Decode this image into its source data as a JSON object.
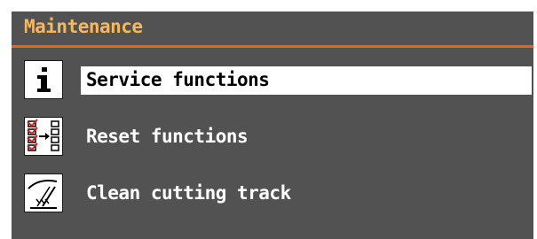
{
  "header": {
    "title": "Maintenance",
    "accent_color": "#e8651e",
    "title_color": "#f4b860"
  },
  "menu": {
    "items": [
      {
        "label": "Service functions",
        "icon": "info-icon",
        "selected": true
      },
      {
        "label": "Reset functions",
        "icon": "reset-functions-icon",
        "selected": false
      },
      {
        "label": "Clean cutting track",
        "icon": "clean-cutting-track-icon",
        "selected": false
      }
    ]
  },
  "colors": {
    "panel_background": "#525252",
    "selection_background": "#ffffff",
    "text": "#ffffff",
    "selected_text": "#000000"
  }
}
